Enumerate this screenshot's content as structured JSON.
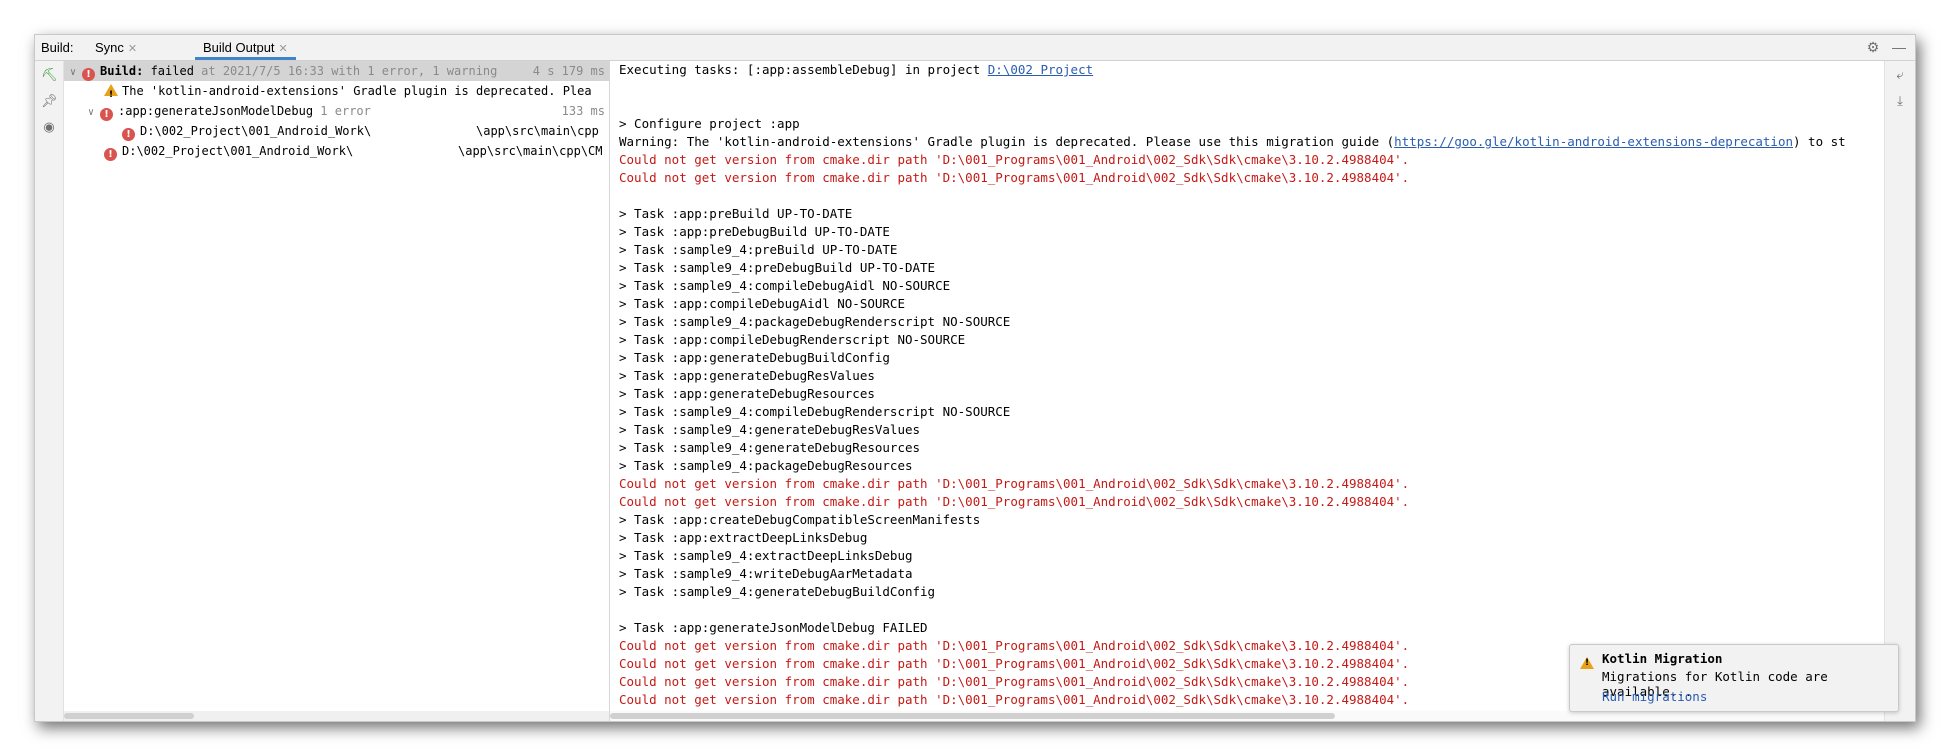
{
  "tabbar": {
    "label": "Build:",
    "tabs": [
      {
        "label": "Sync",
        "active": false
      },
      {
        "label": "Build Output",
        "active": true
      }
    ],
    "icons": [
      "settings-gear-icon",
      "minimize-icon"
    ]
  },
  "gutter": {
    "icons": [
      "hammer-icon",
      "pin-icon",
      "eye-icon"
    ]
  },
  "tree": {
    "rows": [
      {
        "bold": "Build:",
        "text": " failed",
        "meta": " at 2021/7/5 16:33 with 1 error, 1 warning",
        "right": "4 s 179 ms"
      },
      {
        "text": "The 'kotlin-android-extensions' Gradle plugin is deprecated. Plea"
      },
      {
        "text": ":app:generateJsonModelDebug",
        "meta": "  1 error",
        "right": "133 ms"
      },
      {
        "text": "D:\\002_Project\\001_Android_Work\\",
        "tail": "\\app\\src\\main\\cpp"
      },
      {
        "text": "D:\\002_Project\\001_Android_Work\\",
        "tail": "\\app\\src\\main\\cpp\\CM"
      }
    ]
  },
  "console": {
    "lines": [
      {
        "type": "normal",
        "text": "Executing tasks: [:app:assembleDebug] in project ",
        "link": "D:\\002 Project"
      },
      {
        "type": "normal",
        "text": ""
      },
      {
        "type": "normal",
        "text": ""
      },
      {
        "type": "normal",
        "text": "> Configure project :app"
      },
      {
        "type": "normal",
        "text": "Warning: The 'kotlin-android-extensions' Gradle plugin is deprecated. Please use this migration guide (",
        "link": "https://goo.gle/kotlin-android-extensions-deprecation",
        "after": ") to st"
      },
      {
        "type": "err",
        "text": "Could not get version from cmake.dir path 'D:\\001_Programs\\001_Android\\002_Sdk\\Sdk\\cmake\\3.10.2.4988404'."
      },
      {
        "type": "err",
        "text": "Could not get version from cmake.dir path 'D:\\001_Programs\\001_Android\\002_Sdk\\Sdk\\cmake\\3.10.2.4988404'."
      },
      {
        "type": "normal",
        "text": ""
      },
      {
        "type": "normal",
        "text": "> Task :app:preBuild UP-TO-DATE"
      },
      {
        "type": "normal",
        "text": "> Task :app:preDebugBuild UP-TO-DATE"
      },
      {
        "type": "normal",
        "text": "> Task :sample9_4:preBuild UP-TO-DATE"
      },
      {
        "type": "normal",
        "text": "> Task :sample9_4:preDebugBuild UP-TO-DATE"
      },
      {
        "type": "normal",
        "text": "> Task :sample9_4:compileDebugAidl NO-SOURCE"
      },
      {
        "type": "normal",
        "text": "> Task :app:compileDebugAidl NO-SOURCE"
      },
      {
        "type": "normal",
        "text": "> Task :sample9_4:packageDebugRenderscript NO-SOURCE"
      },
      {
        "type": "normal",
        "text": "> Task :app:compileDebugRenderscript NO-SOURCE"
      },
      {
        "type": "normal",
        "text": "> Task :app:generateDebugBuildConfig"
      },
      {
        "type": "normal",
        "text": "> Task :app:generateDebugResValues"
      },
      {
        "type": "normal",
        "text": "> Task :app:generateDebugResources"
      },
      {
        "type": "normal",
        "text": "> Task :sample9_4:compileDebugRenderscript NO-SOURCE"
      },
      {
        "type": "normal",
        "text": "> Task :sample9_4:generateDebugResValues"
      },
      {
        "type": "normal",
        "text": "> Task :sample9_4:generateDebugResources"
      },
      {
        "type": "normal",
        "text": "> Task :sample9_4:packageDebugResources"
      },
      {
        "type": "err",
        "text": "Could not get version from cmake.dir path 'D:\\001_Programs\\001_Android\\002_Sdk\\Sdk\\cmake\\3.10.2.4988404'."
      },
      {
        "type": "err",
        "text": "Could not get version from cmake.dir path 'D:\\001_Programs\\001_Android\\002_Sdk\\Sdk\\cmake\\3.10.2.4988404'."
      },
      {
        "type": "normal",
        "text": "> Task :app:createDebugCompatibleScreenManifests"
      },
      {
        "type": "normal",
        "text": "> Task :app:extractDeepLinksDebug"
      },
      {
        "type": "normal",
        "text": "> Task :sample9_4:extractDeepLinksDebug"
      },
      {
        "type": "normal",
        "text": "> Task :sample9_4:writeDebugAarMetadata"
      },
      {
        "type": "normal",
        "text": "> Task :sample9_4:generateDebugBuildConfig"
      },
      {
        "type": "normal",
        "text": ""
      },
      {
        "type": "normal",
        "text": "> Task :app:generateJsonModelDebug FAILED"
      },
      {
        "type": "err",
        "text": "Could not get version from cmake.dir path 'D:\\001_Programs\\001_Android\\002_Sdk\\Sdk\\cmake\\3.10.2.4988404'."
      },
      {
        "type": "err",
        "text": "Could not get version from cmake.dir path 'D:\\001_Programs\\001_Android\\002_Sdk\\Sdk\\cmake\\3.10.2.4988404'."
      },
      {
        "type": "err",
        "text": "Could not get version from cmake.dir path 'D:\\001_Programs\\001_Android\\002_Sdk\\Sdk\\cmake\\3.10.2.4988404'."
      },
      {
        "type": "err",
        "text": "Could not get version from cmake.dir path 'D:\\001_Programs\\001_Android\\002_Sdk\\Sdk\\cmake\\3.10.2.4988404'."
      }
    ]
  },
  "notification": {
    "title": "Kotlin Migration",
    "body": "Migrations for Kotlin code are available...",
    "link": "Run migrations"
  },
  "colors": {
    "error_text": "#c41a16",
    "link": "#2a5db0",
    "error_icon": "#d9534f",
    "warning_icon": "#e8a21a",
    "active_tab": "#4083c9"
  }
}
